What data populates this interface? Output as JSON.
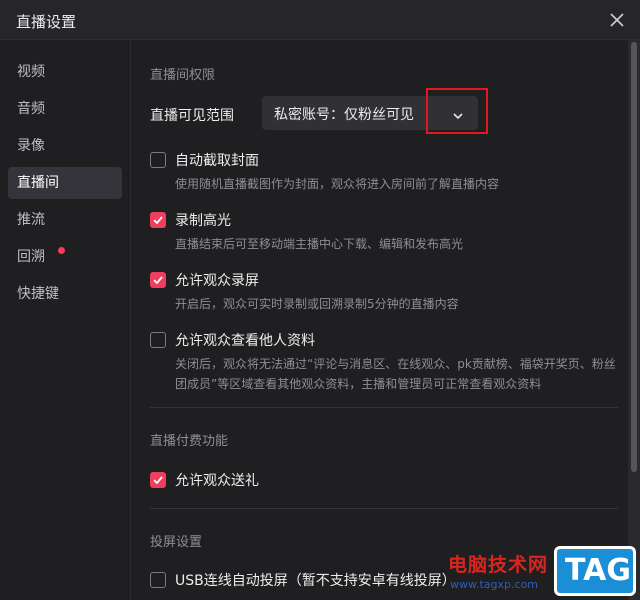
{
  "window": {
    "title": "直播设置"
  },
  "sidebar": {
    "items": [
      {
        "label": "视频"
      },
      {
        "label": "音频"
      },
      {
        "label": "录像"
      },
      {
        "label": "直播间"
      },
      {
        "label": "推流"
      },
      {
        "label": "回溯"
      },
      {
        "label": "快捷键"
      }
    ],
    "active_index": 3
  },
  "main": {
    "section_permissions": "直播间权限",
    "visibility_label": "直播可见范围",
    "visibility_value": "私密账号：仅粉丝可见",
    "options": [
      {
        "label": "自动截取封面",
        "desc": "使用随机直播截图作为封面，观众将进入房间前了解直播内容",
        "checked": false
      },
      {
        "label": "录制高光",
        "desc": "直播结束后可至移动端主播中心下载、编辑和发布高光",
        "checked": true
      },
      {
        "label": "允许观众录屏",
        "desc": "开启后，观众可实时录制或回溯录制5分钟的直播内容",
        "checked": true
      },
      {
        "label": "允许观众查看他人资料",
        "desc": "关闭后，观众将无法通过“评论与消息区、在线观众、pk贡献榜、福袋开奖页、粉丝团成员”等区域查看其他观众资料，主播和管理员可正常查看观众资料",
        "checked": false
      }
    ],
    "section_paid": "直播付费功能",
    "gift_label": "允许观众送礼",
    "gift_checked": true,
    "section_cast": "投屏设置",
    "usb_label": "USB连线自动投屏（暂不支持安卓有线投屏）",
    "usb_checked": false
  },
  "watermark": {
    "title": "电脑技术网",
    "url": "www.tagxp.com",
    "badge": "TAG"
  },
  "colors": {
    "accent": "#ef3f5e",
    "highlight": "#e0191e",
    "background": "#1f1f21"
  }
}
